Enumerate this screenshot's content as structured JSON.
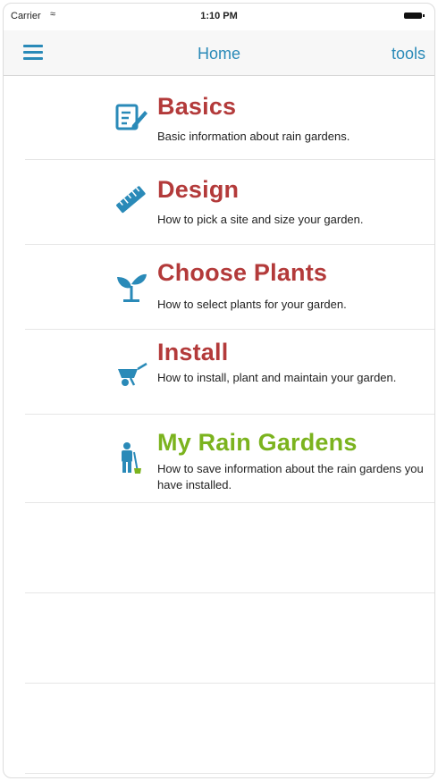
{
  "status": {
    "carrier": "Carrier",
    "time": "1:10 PM"
  },
  "nav": {
    "title": "Home",
    "tools_label": "tools",
    "menu_icon": "hamburger-menu-icon"
  },
  "items": [
    {
      "title": "Basics",
      "desc": "Basic information about rain gardens.",
      "icon": "notepad-pencil-icon",
      "color": "#b33a3a"
    },
    {
      "title": "Design",
      "desc": "How to pick a site and size your garden.",
      "icon": "ruler-icon",
      "color": "#b33a3a"
    },
    {
      "title": "Choose Plants",
      "desc": "How to select plants for your garden.",
      "icon": "seedling-icon",
      "color": "#b33a3a"
    },
    {
      "title": "Install",
      "desc": "How to install, plant and maintain your garden.",
      "icon": "wheelbarrow-icon",
      "color": "#b33a3a"
    },
    {
      "title": "My Rain Gardens",
      "desc": "How to save information about the rain gardens you have installed.",
      "icon": "gardener-icon",
      "color": "#7bb31e"
    }
  ],
  "colors": {
    "accent": "#2a8ab8",
    "title_red": "#b33a3a",
    "title_green": "#7bb31e"
  }
}
